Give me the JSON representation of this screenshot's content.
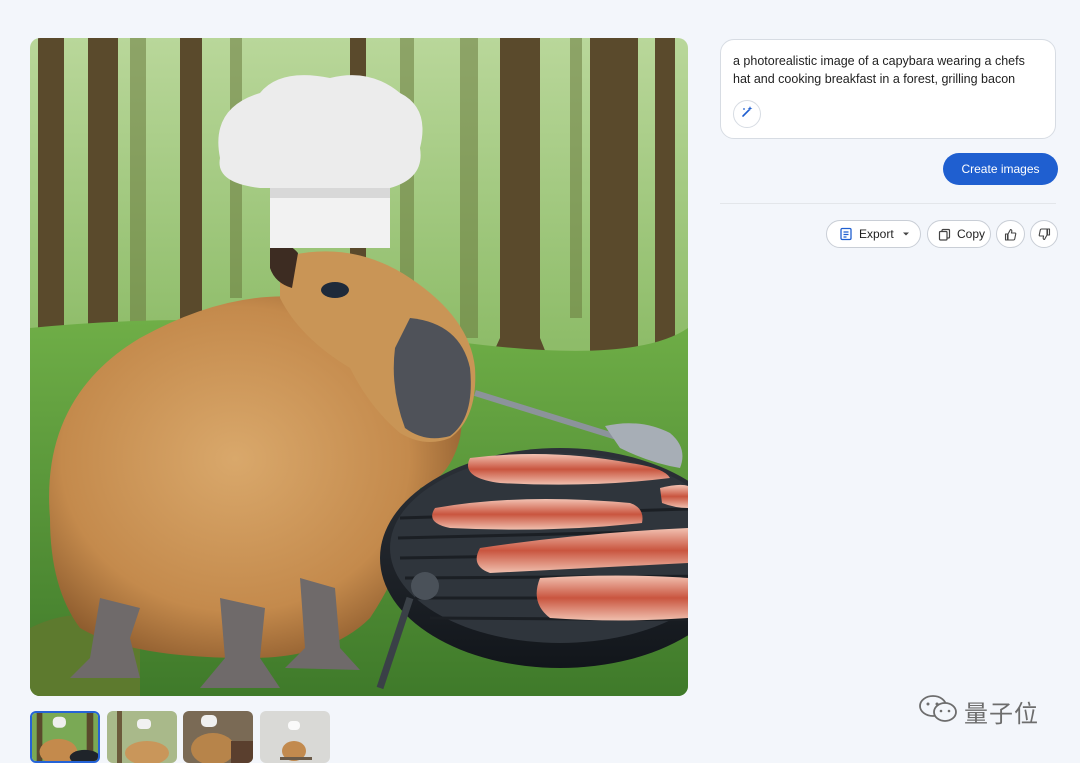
{
  "prompt": {
    "text": "a photorealistic image of a capybara wearing a chefs hat and cooking breakfast in a forest, grilling bacon"
  },
  "actions": {
    "create_label": "Create images",
    "export_label": "Export",
    "copy_label": "Copy"
  },
  "watermark": {
    "text": "量子位"
  },
  "colors": {
    "accent": "#1f5fd0",
    "background": "#f3f6fb",
    "thumb_selected_border": "#2563d6"
  },
  "icons": {
    "wand": "magic-wand-icon",
    "export": "export-sheet-icon",
    "dropdown": "caret-down-icon",
    "copy": "copy-icon",
    "like": "thumbs-up-icon",
    "dislike": "thumbs-down-icon"
  }
}
